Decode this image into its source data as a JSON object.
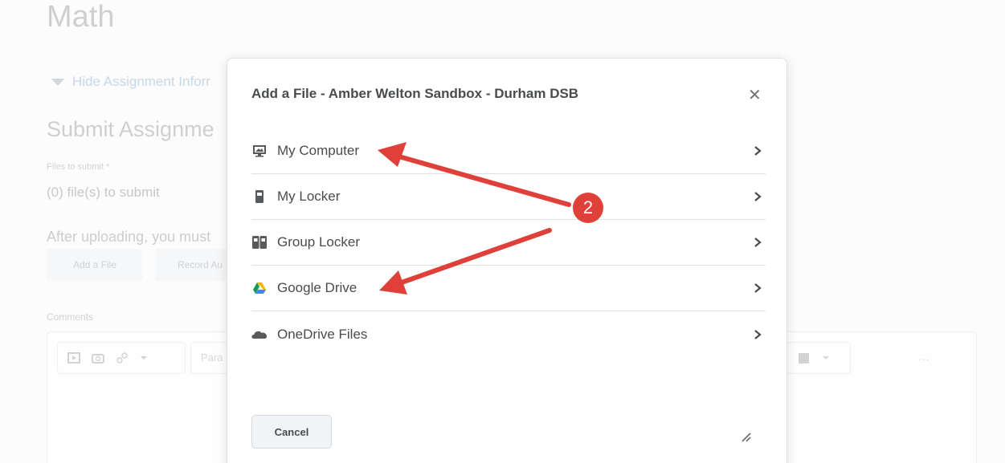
{
  "background": {
    "page_title": "Math",
    "toggle_label": "Hide Assignment Inforr",
    "section_title": "Submit Assignme",
    "files_label": "Files to submit *",
    "files_count": "(0) file(s) to submit",
    "after_upload": "After uploading, you must",
    "add_file_label": "Add a File",
    "record_label": "Record Au",
    "comments_label": "Comments",
    "editor_paragraph": "Para",
    "editor_more": "..."
  },
  "modal": {
    "title": "Add a File - Amber Welton Sandbox - Durham DSB",
    "close_icon": "close-icon",
    "options": [
      {
        "label": "My Computer",
        "icon": "computer-icon"
      },
      {
        "label": "My Locker",
        "icon": "locker-icon"
      },
      {
        "label": "Group Locker",
        "icon": "group-locker-icon"
      },
      {
        "label": "Google Drive",
        "icon": "google-drive-icon"
      },
      {
        "label": "OneDrive Files",
        "icon": "onedrive-icon"
      }
    ],
    "cancel_label": "Cancel"
  },
  "annotation": {
    "badge_number": "2",
    "color": "#e0403a"
  }
}
